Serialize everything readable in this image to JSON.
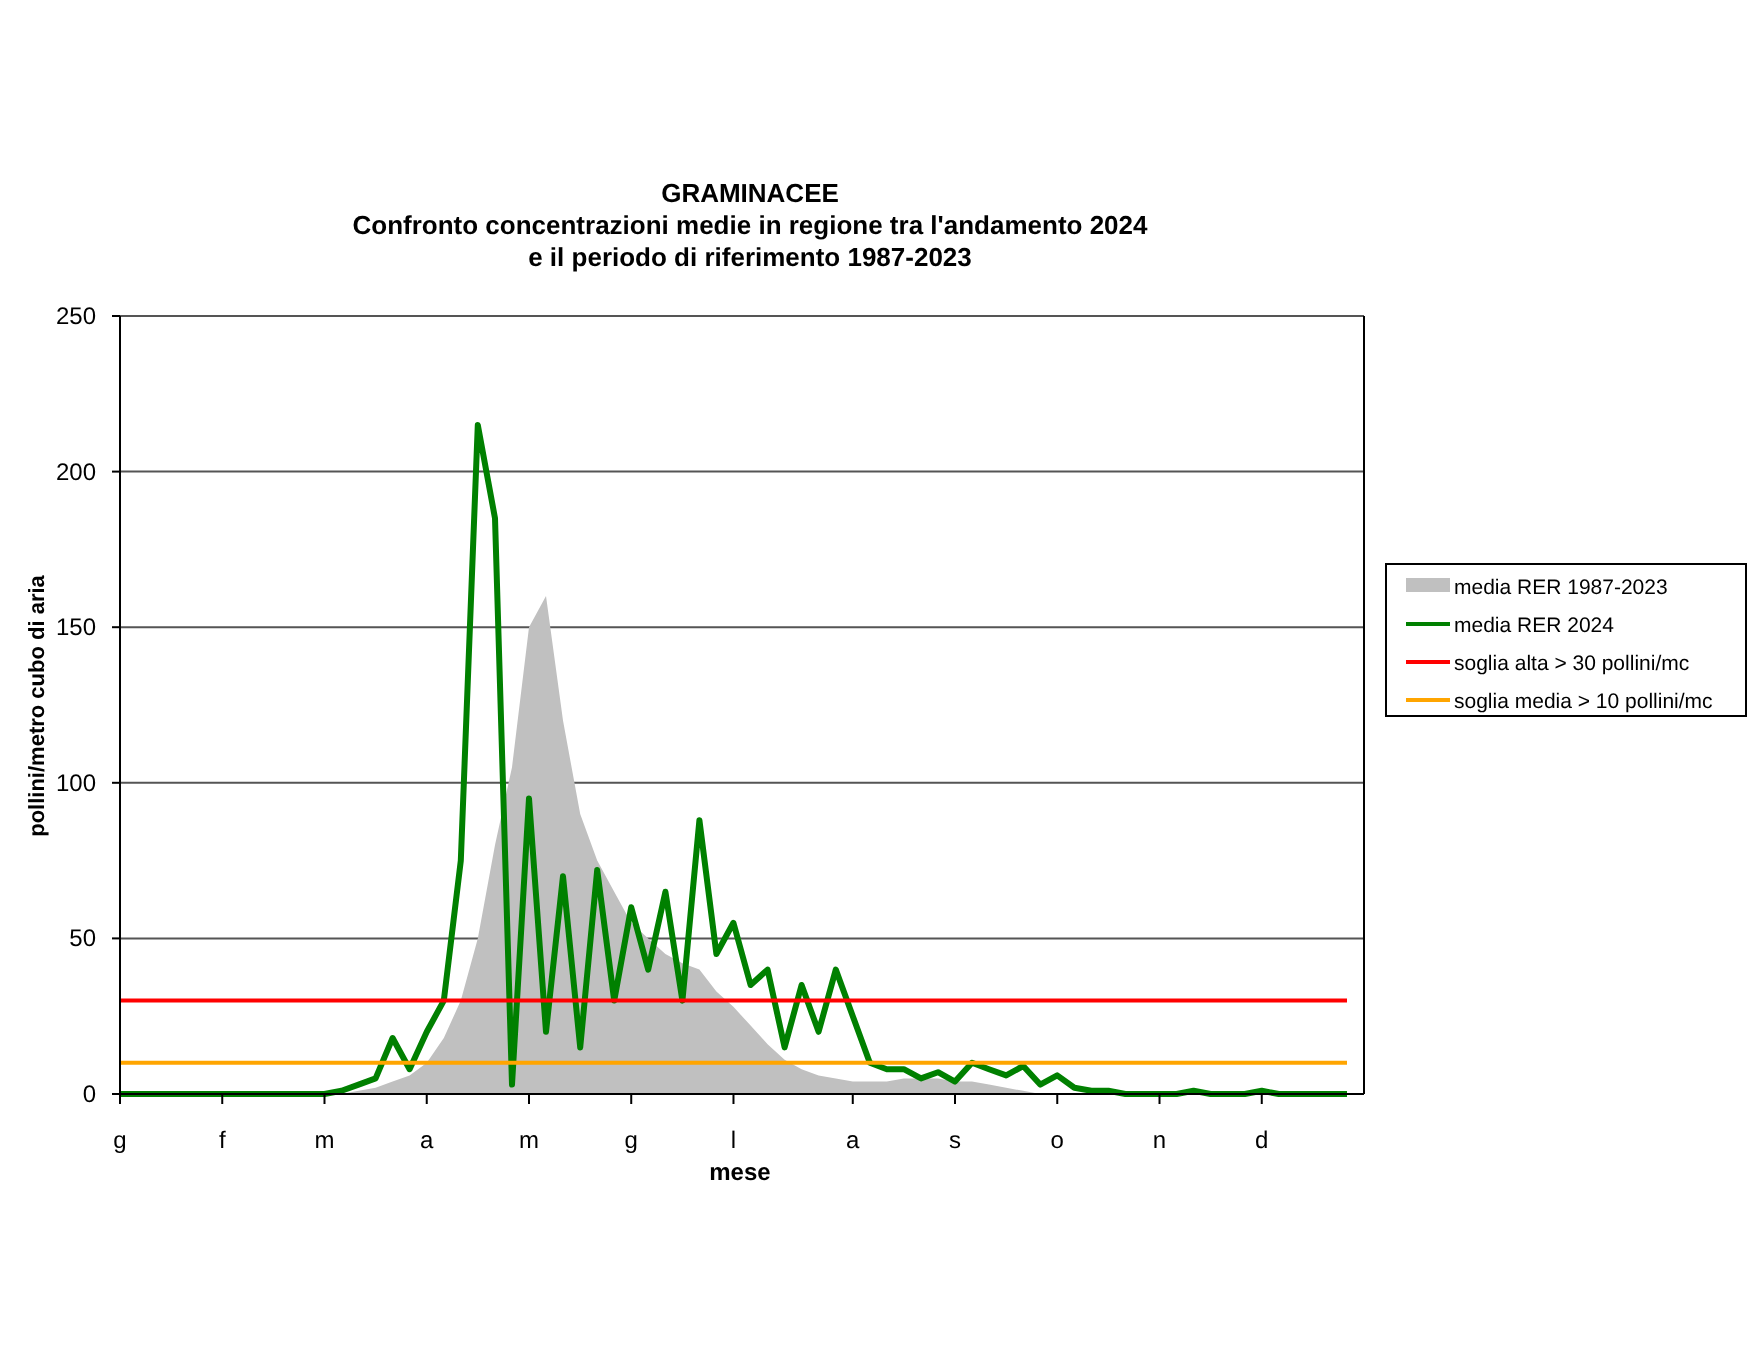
{
  "chart_data": {
    "type": "line",
    "legend": true,
    "grid": true,
    "title": "GRAMINACEE\nConfronto concentrazioni medie in regione tra l'andamento 2024\ne il periodo di riferimento 1987-2023",
    "xlabel": "mese",
    "ylabel": "pollini/metro cubo di aria",
    "ylim": [
      0,
      250
    ],
    "yticks": [
      0,
      50,
      100,
      150,
      200,
      250
    ],
    "categories": [
      "g",
      null,
      null,
      null,
      null,
      null,
      "f",
      null,
      null,
      null,
      null,
      null,
      "m",
      null,
      null,
      null,
      null,
      null,
      "a",
      null,
      null,
      null,
      null,
      null,
      "m",
      null,
      null,
      null,
      null,
      null,
      "g",
      null,
      null,
      null,
      null,
      null,
      "l",
      null,
      null,
      null,
      null,
      null,
      null,
      "a",
      null,
      null,
      null,
      null,
      null,
      "s",
      null,
      null,
      null,
      null,
      null,
      "o",
      null,
      null,
      null,
      null,
      null,
      "n",
      null,
      null,
      null,
      null,
      null,
      "d",
      null,
      null,
      null,
      null,
      null
    ],
    "series": [
      {
        "name": "media RER 1987-2023",
        "type": "area",
        "color": "#c0c0c0",
        "values": [
          0,
          0,
          0,
          0,
          0,
          0,
          0,
          0,
          0,
          0,
          0,
          0,
          0,
          0,
          1,
          2,
          4,
          6,
          10,
          18,
          30,
          50,
          80,
          105,
          150,
          160,
          120,
          90,
          75,
          65,
          55,
          50,
          45,
          42,
          40,
          33,
          28,
          22,
          16,
          11,
          8,
          6,
          5,
          4,
          4,
          4,
          5,
          5,
          5,
          4,
          4,
          3,
          2,
          1,
          0,
          0,
          0,
          0,
          0,
          0,
          0,
          0,
          0,
          0,
          0,
          0,
          0,
          0,
          0,
          0,
          0,
          0,
          0
        ]
      },
      {
        "name": "media RER 2024",
        "color": "#008000",
        "values": [
          0,
          0,
          0,
          0,
          0,
          0,
          0,
          0,
          0,
          0,
          0,
          0,
          0,
          1,
          3,
          5,
          18,
          8,
          20,
          30,
          75,
          215,
          185,
          3,
          95,
          20,
          70,
          15,
          72,
          30,
          60,
          40,
          65,
          30,
          88,
          45,
          55,
          35,
          40,
          15,
          35,
          20,
          40,
          25,
          10,
          8,
          8,
          5,
          7,
          4,
          10,
          8,
          6,
          9,
          3,
          6,
          2,
          1,
          1,
          0,
          0,
          0,
          0,
          1,
          0,
          0,
          0,
          1,
          0,
          0,
          0,
          0,
          0
        ]
      },
      {
        "name": "soglia alta > 30 pollini/mc",
        "color": "#ff0000",
        "values": [
          30,
          30,
          30,
          30,
          30,
          30,
          30,
          30,
          30,
          30,
          30,
          30,
          30,
          30,
          30,
          30,
          30,
          30,
          30,
          30,
          30,
          30,
          30,
          30,
          30,
          30,
          30,
          30,
          30,
          30,
          30,
          30,
          30,
          30,
          30,
          30,
          30,
          30,
          30,
          30,
          30,
          30,
          30,
          30,
          30,
          30,
          30,
          30,
          30,
          30,
          30,
          30,
          30,
          30,
          30,
          30,
          30,
          30,
          30,
          30,
          30,
          30,
          30,
          30,
          30,
          30,
          30,
          30,
          30,
          30,
          30,
          30,
          30
        ]
      },
      {
        "name": "soglia media > 10 pollini/mc",
        "color": "#ffa500",
        "values": [
          10,
          10,
          10,
          10,
          10,
          10,
          10,
          10,
          10,
          10,
          10,
          10,
          10,
          10,
          10,
          10,
          10,
          10,
          10,
          10,
          10,
          10,
          10,
          10,
          10,
          10,
          10,
          10,
          10,
          10,
          10,
          10,
          10,
          10,
          10,
          10,
          10,
          10,
          10,
          10,
          10,
          10,
          10,
          10,
          10,
          10,
          10,
          10,
          10,
          10,
          10,
          10,
          10,
          10,
          10,
          10,
          10,
          10,
          10,
          10,
          10,
          10,
          10,
          10,
          10,
          10,
          10,
          10,
          10,
          10,
          10,
          10,
          10
        ]
      }
    ]
  }
}
